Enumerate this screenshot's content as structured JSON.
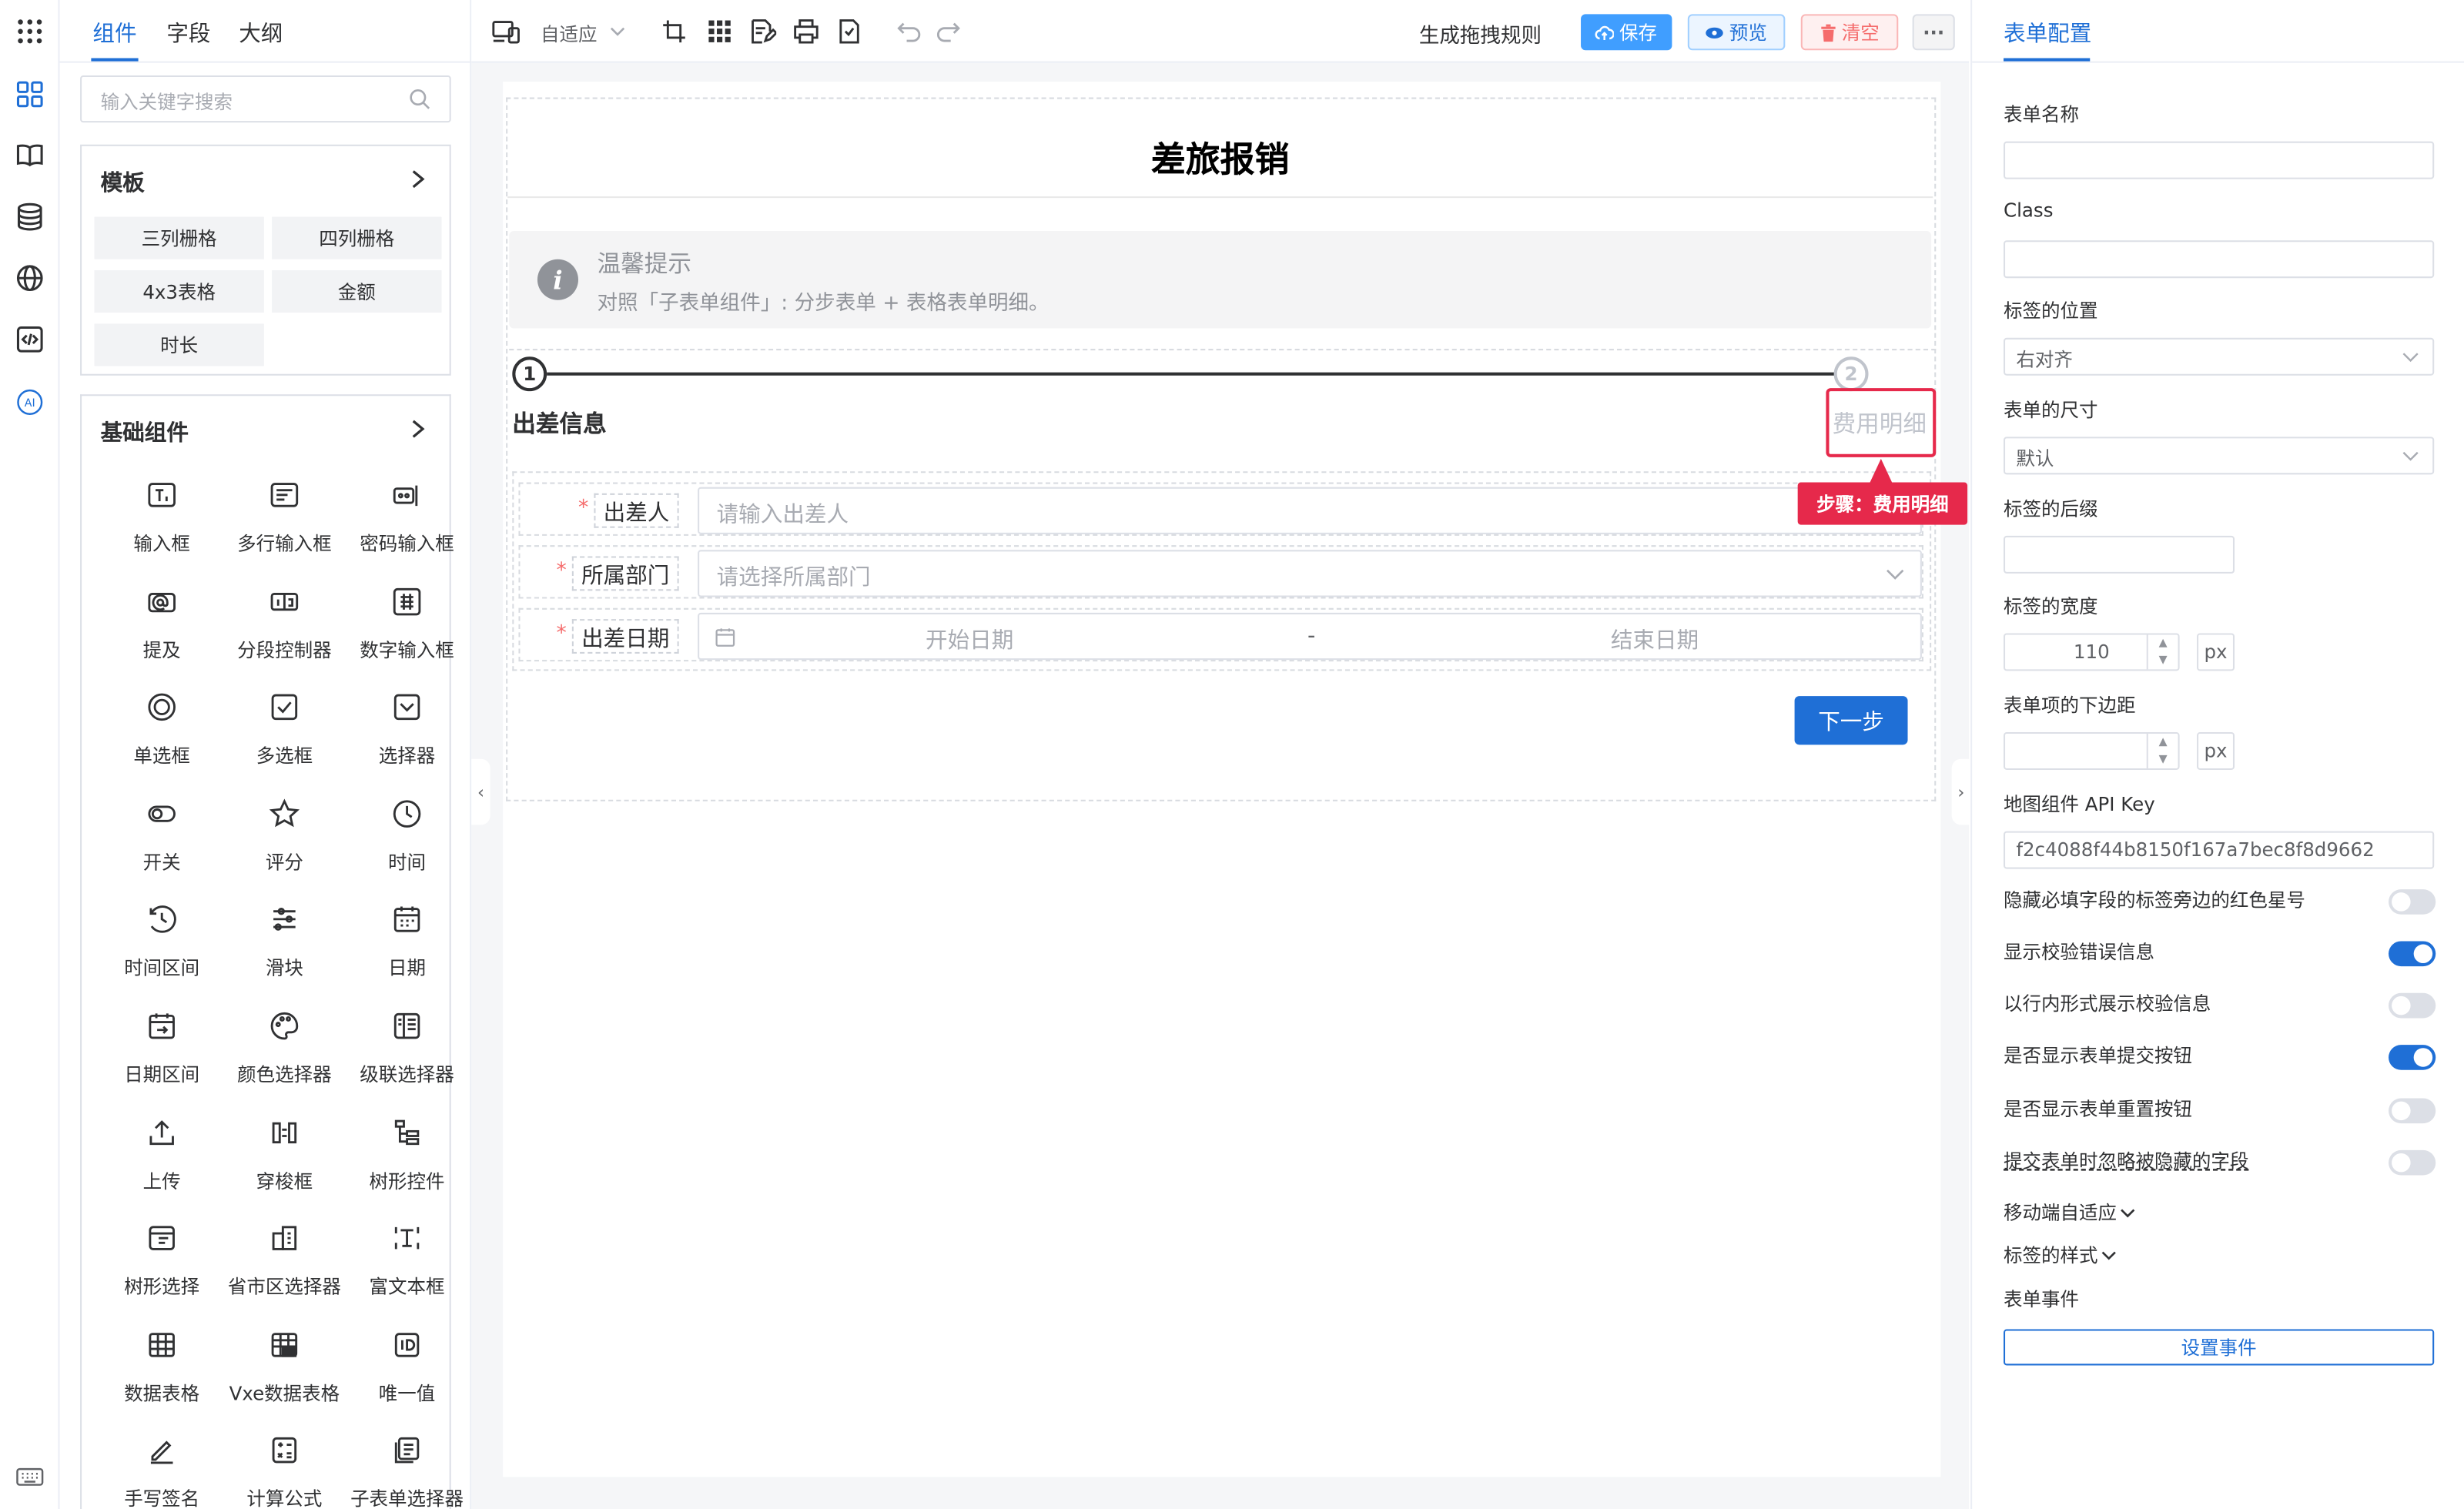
{
  "left_tabs": [
    "组件",
    "字段",
    "大纲"
  ],
  "search": {
    "placeholder": "输入关键字搜索"
  },
  "templates": {
    "title": "模板",
    "items": [
      "三列栅格",
      "四列栅格",
      "4x3表格",
      "金额",
      "时长"
    ]
  },
  "basic": {
    "title": "基础组件",
    "items": [
      {
        "label": "输入框",
        "icon": "text-input-icon"
      },
      {
        "label": "多行输入框",
        "icon": "textarea-icon"
      },
      {
        "label": "密码输入框",
        "icon": "password-icon"
      },
      {
        "label": "提及",
        "icon": "mention-icon"
      },
      {
        "label": "分段控制器",
        "icon": "segmented-icon"
      },
      {
        "label": "数字输入框",
        "icon": "number-input-icon"
      },
      {
        "label": "单选框",
        "icon": "radio-icon"
      },
      {
        "label": "多选框",
        "icon": "checkbox-icon"
      },
      {
        "label": "选择器",
        "icon": "select-icon"
      },
      {
        "label": "开关",
        "icon": "switch-icon"
      },
      {
        "label": "评分",
        "icon": "star-icon"
      },
      {
        "label": "时间",
        "icon": "clock-icon"
      },
      {
        "label": "时间区间",
        "icon": "time-range-icon"
      },
      {
        "label": "滑块",
        "icon": "slider-icon"
      },
      {
        "label": "日期",
        "icon": "calendar-icon"
      },
      {
        "label": "日期区间",
        "icon": "date-range-icon"
      },
      {
        "label": "颜色选择器",
        "icon": "palette-icon"
      },
      {
        "label": "级联选择器",
        "icon": "cascader-icon"
      },
      {
        "label": "上传",
        "icon": "upload-icon"
      },
      {
        "label": "穿梭框",
        "icon": "transfer-icon"
      },
      {
        "label": "树形控件",
        "icon": "tree-icon"
      },
      {
        "label": "树形选择",
        "icon": "tree-select-icon"
      },
      {
        "label": "省市区选择器",
        "icon": "region-icon"
      },
      {
        "label": "富文本框",
        "icon": "rich-text-icon"
      },
      {
        "label": "数据表格",
        "icon": "table-icon"
      },
      {
        "label": "Vxe数据表格",
        "icon": "vxe-table-icon"
      },
      {
        "label": "唯一值",
        "icon": "id-icon"
      },
      {
        "label": "手写签名",
        "icon": "signature-icon"
      },
      {
        "label": "计算公式",
        "icon": "calculator-icon"
      },
      {
        "label": "子表单选择器",
        "icon": "subform-icon"
      }
    ]
  },
  "toolbar": {
    "adapt": "自适应",
    "rules": "生成拖拽规则",
    "save": "保存",
    "preview": "预览",
    "clear": "清空",
    "more": "···"
  },
  "form": {
    "title": "差旅报销",
    "alert_title": "温馨提示",
    "alert_desc": "对照「子表单组件」: 分步表单 + 表格表单明细。",
    "step1_num": "1",
    "step1_label": "出差信息",
    "step2_num": "2",
    "step2_label": "费用明细",
    "fields": [
      {
        "label": "出差人",
        "placeholder": "请输入出差人"
      },
      {
        "label": "所属部门",
        "placeholder": "请选择所属部门"
      },
      {
        "label": "出差日期",
        "start": "开始日期",
        "sep": "-",
        "end": "结束日期"
      }
    ],
    "next": "下一步",
    "selection_tip": "步骤：费用明细"
  },
  "right": {
    "tab": "表单配置",
    "form_name": "表单名称",
    "class": "Class",
    "label_position": "标签的位置",
    "label_position_value": "右对齐",
    "form_size": "表单的尺寸",
    "form_size_value": "默认",
    "label_suffix": "标签的后缀",
    "label_width": "标签的宽度",
    "label_width_value": "110",
    "unit": "px",
    "item_margin": "表单项的下边距",
    "map_key": "地图组件 API Key",
    "map_key_value": "f2c4088f44b8150f167a7bec8f8d9662",
    "toggles": [
      {
        "label": "隐藏必填字段的标签旁边的红色星号",
        "on": false
      },
      {
        "label": "显示校验错误信息",
        "on": true
      },
      {
        "label": "以行内形式展示校验信息",
        "on": false
      },
      {
        "label": "是否显示表单提交按钮",
        "on": true
      },
      {
        "label": "是否显示表单重置按钮",
        "on": false
      },
      {
        "label": "提交表单时忽略被隐藏的字段",
        "on": false
      }
    ],
    "mobile": "移动端自适应",
    "label_style": "标签的样式",
    "events": "表单事件",
    "set_event": "设置事件"
  },
  "colors": {
    "primary": "#1f6fd6",
    "danger": "#e6294b",
    "toggle_off": "#dcdfe6"
  }
}
